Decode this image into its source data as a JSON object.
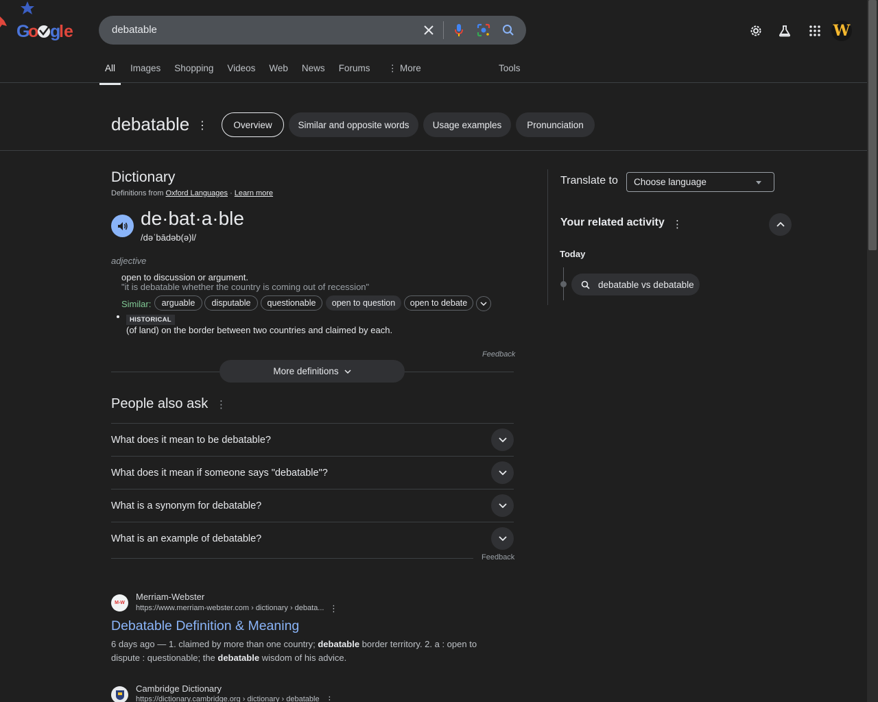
{
  "search": {
    "query": "debatable"
  },
  "tabs": [
    "All",
    "Images",
    "Shopping",
    "Videos",
    "Web",
    "News",
    "Forums"
  ],
  "more_tab": "More",
  "tools": "Tools",
  "word_header": {
    "title": "debatable",
    "chips": [
      "Overview",
      "Similar and opposite words",
      "Usage examples",
      "Pronunciation"
    ]
  },
  "dictionary": {
    "title": "Dictionary",
    "source_prefix": "Definitions from",
    "source_link": "Oxford Languages",
    "separator": "·",
    "learn_more": "Learn more",
    "headword": "de·bat·a·ble",
    "pronunciation": "/dəˈbādəb(ə)l/",
    "pos": "adjective",
    "definition": "open to discussion or argument.",
    "example": "\"it is debatable whether the country is coming out of recession\"",
    "similar_label": "Similar:",
    "similar": [
      "arguable",
      "disputable",
      "questionable",
      "open to question",
      "open to debate"
    ],
    "badge": "HISTORICAL",
    "definition2": "(of land) on the border between two countries and claimed by each.",
    "feedback": "Feedback",
    "more_definitions": "More definitions"
  },
  "paa": {
    "title": "People also ask",
    "questions": [
      "What does it mean to be debatable?",
      "What does it mean if someone says \"debatable\"?",
      "What is a synonym for debatable?",
      "What is an example of debatable?"
    ],
    "feedback": "Feedback"
  },
  "results": [
    {
      "site": "Merriam-Webster",
      "favicon": "M-W",
      "url": "https://www.merriam-webster.com › dictionary › debata...",
      "title": "Debatable Definition & Meaning",
      "date": "6 days ago",
      "dash": " — ",
      "s1": "1. claimed by more than one country; ",
      "b1": "debatable",
      "s2": " border territory. 2. a : open to dispute : questionable; the ",
      "b2": "debatable",
      "s3": " wisdom of his advice."
    },
    {
      "site": "Cambridge Dictionary",
      "url": "https://dictionary.cambridge.org › dictionary › debatable"
    }
  ],
  "right_panel": {
    "translate_label": "Translate to",
    "language_select": "Choose language",
    "related_title": "Your related activity",
    "today": "Today",
    "activity": "debatable vs debatable"
  },
  "avatar_letter": "W",
  "colors": {
    "accent_link": "#8ab4f8",
    "background": "#1f1f1f",
    "similar_label": "#81c995"
  }
}
